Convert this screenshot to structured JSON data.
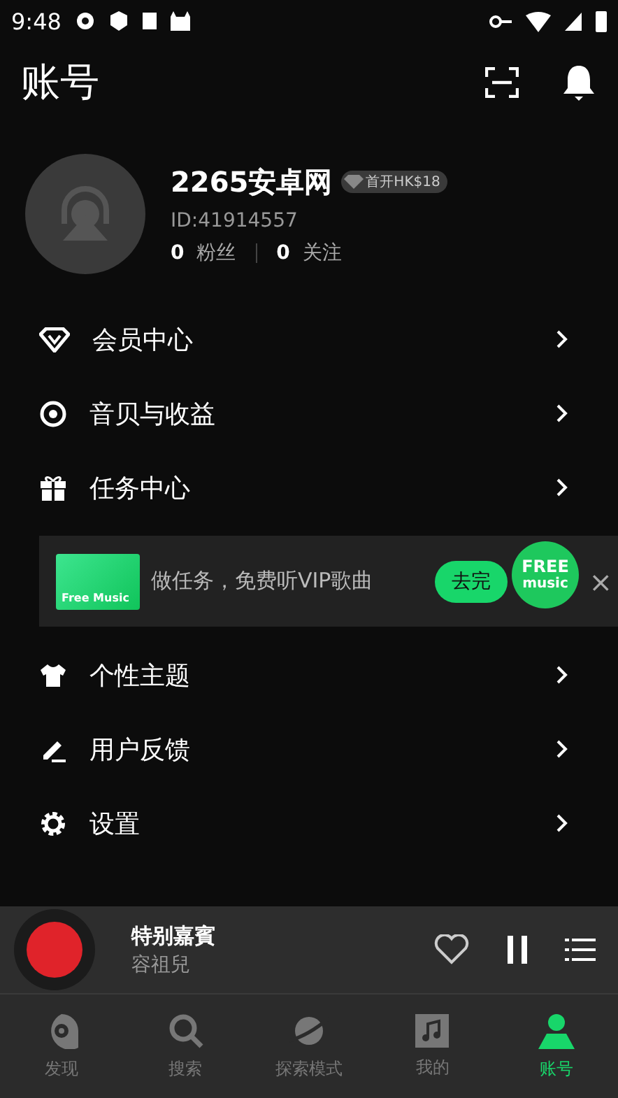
{
  "status_bar": {
    "time": "9:48"
  },
  "header": {
    "title": "账号"
  },
  "profile": {
    "name": "2265安卓网",
    "vip_badge": "首开HK$18",
    "id": "ID:41914557",
    "fans_count": "0",
    "fans_label": "粉丝",
    "follow_count": "0",
    "follow_label": "关注"
  },
  "menu_top": [
    {
      "label": "会员中心"
    },
    {
      "label": "音贝与收益"
    },
    {
      "label": "任务中心"
    }
  ],
  "banner": {
    "card_text": "Free Music",
    "text": "做任务，免费听VIP歌曲",
    "button": "去完",
    "float_badge_line1": "FREE",
    "float_badge_line2": "music",
    "close": "×"
  },
  "menu_bottom": [
    {
      "label": "个性主题"
    },
    {
      "label": "用户反馈"
    },
    {
      "label": "设置"
    }
  ],
  "player": {
    "title": "特别嘉賓",
    "artist": "容祖兒",
    "liked": false,
    "playing": true
  },
  "tabs": [
    {
      "label": "发现",
      "selected": false
    },
    {
      "label": "搜索",
      "selected": false
    },
    {
      "label": "探索模式",
      "selected": false
    },
    {
      "label": "我的",
      "selected": false
    },
    {
      "label": "账号",
      "selected": true
    }
  ]
}
